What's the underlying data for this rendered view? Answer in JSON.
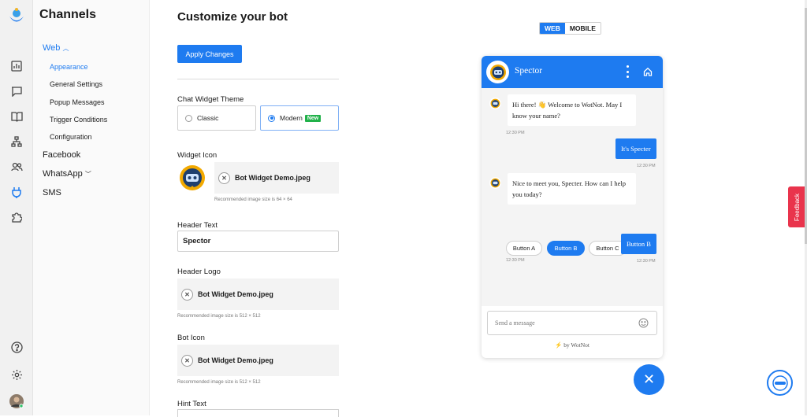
{
  "sidebar": {
    "title": "Channels",
    "items": [
      {
        "label": "Web"
      },
      {
        "label": "Facebook"
      },
      {
        "label": "WhatsApp"
      },
      {
        "label": "SMS"
      }
    ],
    "web_sub": [
      "Appearance",
      "General Settings",
      "Popup Messages",
      "Trigger Conditions",
      "Configuration"
    ]
  },
  "main": {
    "title": "Customize your bot",
    "apply_label": "Apply Changes",
    "theme_label": "Chat Widget Theme",
    "theme_classic": "Classic",
    "theme_modern": "Modern",
    "theme_badge": "New",
    "widget_icon_label": "Widget Icon",
    "widget_icon_file": "Bot Widget Demo.jpeg",
    "widget_icon_hint": "Recommended image size is 64 × 64",
    "header_text_label": "Header Text",
    "header_text_value": "Spector",
    "header_logo_label": "Header Logo",
    "header_logo_file": "Bot Widget Demo.jpeg",
    "header_logo_hint": "Recommended image size is 512 × 512",
    "bot_icon_label": "Bot Icon",
    "bot_icon_file": "Bot Widget Demo.jpeg",
    "bot_icon_hint": "Recommended image size is 512 × 512",
    "hint_text_label": "Hint Text"
  },
  "preview": {
    "tab_web": "WEB",
    "tab_mobile": "MOBILE",
    "bot_name": "Spector",
    "messages": [
      {
        "from": "bot",
        "text": "Hi there! 👋 Welcome to WotNot. May I know your name?",
        "time": "12:30 PM"
      },
      {
        "from": "user",
        "text": "It's Specter",
        "time": "12:30 PM"
      },
      {
        "from": "bot",
        "text": "Nice to meet you, Specter. How can I help you today?",
        "time": ""
      },
      {
        "from": "user",
        "text": "Button B",
        "time": "12:30 PM"
      }
    ],
    "quick_replies": [
      "Button A",
      "Button B",
      "Button C"
    ],
    "quick_reply_time": "12:30 PM",
    "input_placeholder": "Send a message",
    "powered_by": "⚡ by WotNot"
  },
  "feedback_label": "Feedback",
  "colors": {
    "primary": "#1e7bf0",
    "feedback": "#e9344c",
    "badge": "#21b14a"
  }
}
